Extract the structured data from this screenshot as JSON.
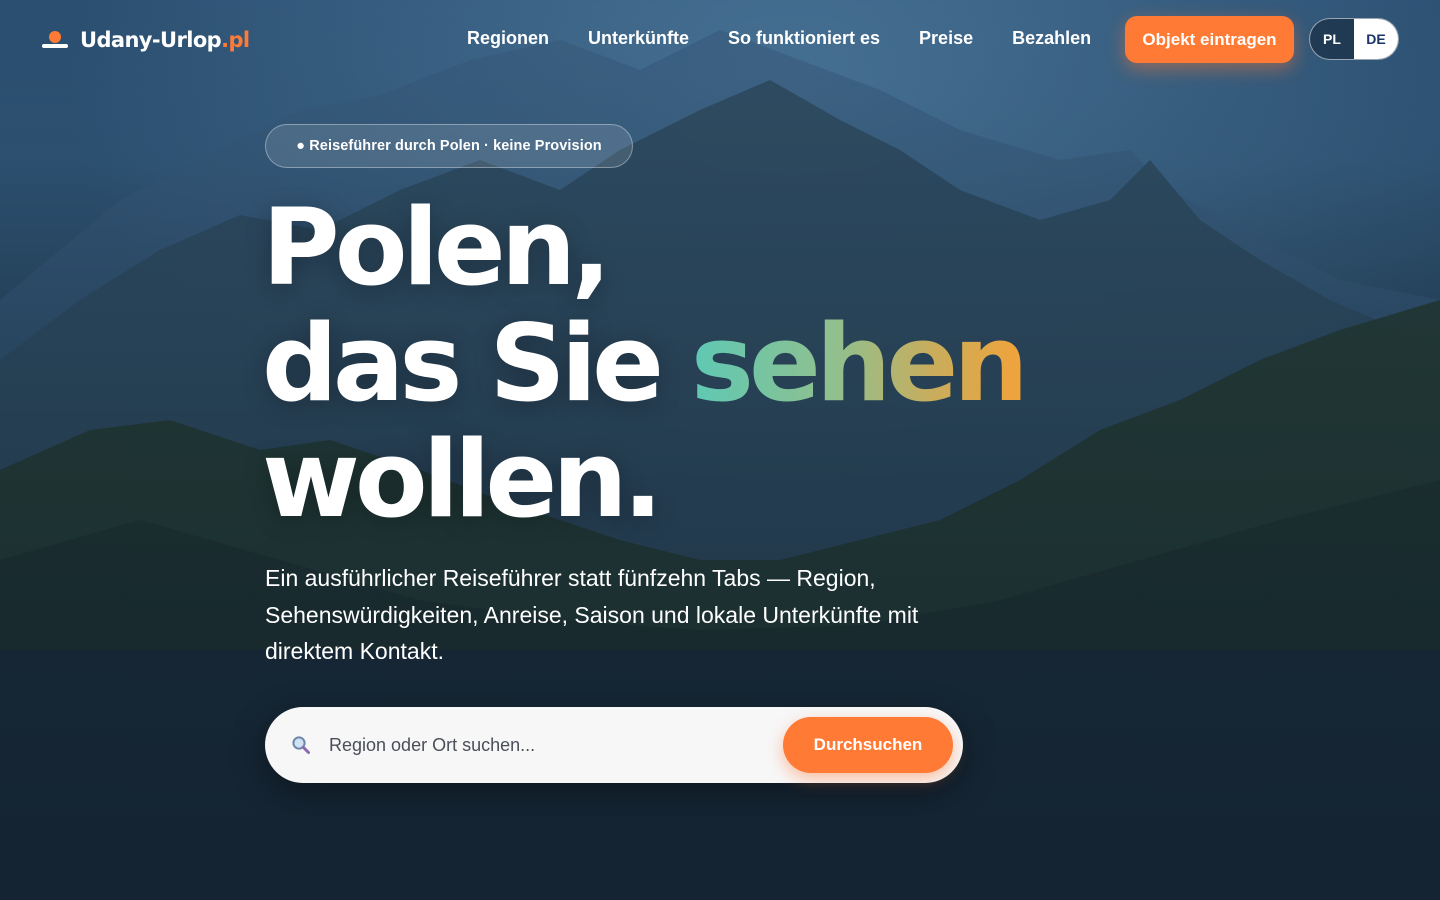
{
  "brand": {
    "name": "Udany-Urlop",
    "tld": ".pl",
    "accent_color": "#ff7a35"
  },
  "nav": {
    "links": [
      "Regionen",
      "Unterkünfte",
      "So funktioniert es",
      "Preise",
      "Bezahlen"
    ],
    "cta_label": "Objekt eintragen",
    "languages": [
      "PL",
      "DE"
    ],
    "active_language": "DE"
  },
  "hero": {
    "badge": "● Reiseführer durch Polen · keine Provision",
    "headline_line1": "Polen,",
    "headline_line2_plain": "das Sie ",
    "headline_line2_accent": "sehen",
    "headline_line3": "wollen.",
    "accent_gradient": [
      "#5ec9b4",
      "#93bf8c",
      "#c8ad5d",
      "#f2a33a"
    ],
    "subtitle": "Ein ausführlicher Reiseführer statt fünfzehn Tabs — Region, Sehenswürdigkeiten, Anreise, Saison und lokale Unterkünfte mit direktem Kontakt."
  },
  "search": {
    "placeholder": "Region oder Ort suchen...",
    "value": "",
    "button_label": "Durchsuchen",
    "icon": "magnifier-icon"
  }
}
